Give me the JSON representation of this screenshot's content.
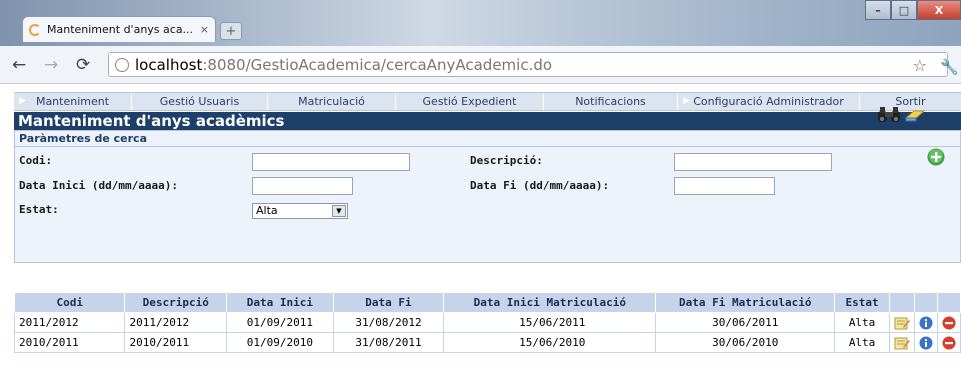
{
  "browser": {
    "tab_title": "Manteniment d'anys aca...",
    "tab_close": "×",
    "new_tab": "+",
    "url_host": "localhost",
    "url_path": ":8080/GestioAcademica/cercaAnyAcademic.do",
    "window_buttons": [
      "–",
      "□",
      "X"
    ]
  },
  "menu": {
    "items": [
      "Manteniment",
      "Gestió Usuaris",
      "Matriculació",
      "Gestió Expedient",
      "Notificacions",
      "Configuració Administrador",
      "Sortir"
    ]
  },
  "page": {
    "title": "Manteniment d'anys acadèmics",
    "search_header": "Paràmetres de cerca"
  },
  "search": {
    "codi_label": "Codi:",
    "codi_value": "",
    "descripcio_label": "Descripció:",
    "descripcio_value": "",
    "data_inici_label": "Data Inici (dd/mm/aaaa):",
    "data_inici_value": "",
    "data_fi_label": "Data Fi (dd/mm/aaaa):",
    "data_fi_value": "",
    "estat_label": "Estat:",
    "estat_value": "Alta"
  },
  "table": {
    "headers": [
      "Codi",
      "Descripció",
      "Data Inici",
      "Data Fi",
      "Data Inici Matriculació",
      "Data Fi Matriculació",
      "Estat"
    ],
    "rows": [
      [
        "2011/2012",
        "2011/2012",
        "01/09/2011",
        "31/08/2012",
        "15/06/2011",
        "30/06/2011",
        "Alta"
      ],
      [
        "2010/2011",
        "2010/2011",
        "01/09/2010",
        "31/08/2011",
        "15/06/2010",
        "30/06/2010",
        "Alta"
      ]
    ]
  },
  "colors": {
    "title_bar": "#1f3f6b",
    "menu_bg": "#dce4f2",
    "table_header": "#c6d3ea"
  }
}
